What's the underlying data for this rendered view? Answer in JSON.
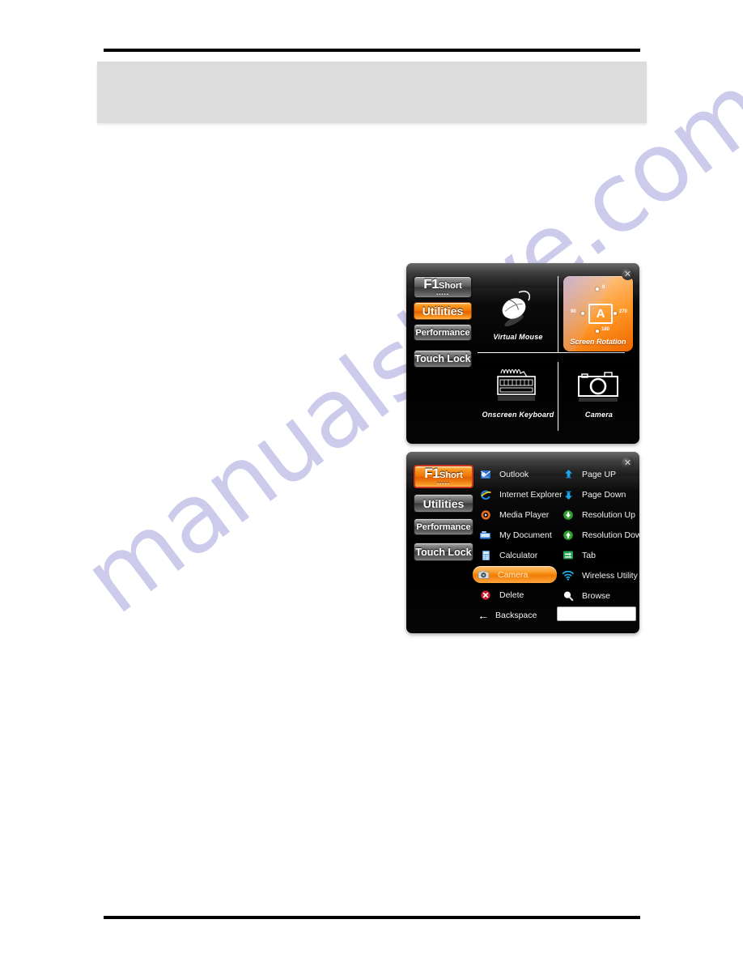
{
  "page": {
    "watermark_text": "manualshive.com"
  },
  "header": {
    "rule": "",
    "box_text": ""
  },
  "footer": {
    "rule": ""
  },
  "panel_utilities": {
    "close_label": "✕",
    "tabs": [
      {
        "id": "f1short",
        "label_main": "F1",
        "label_sub": "Short",
        "dots": "▪▪▪▪▪",
        "state": "normal"
      },
      {
        "id": "utilities",
        "label": "Utilities",
        "state": "active"
      },
      {
        "id": "performance",
        "label": "Performance",
        "state": "normal"
      },
      {
        "id": "touchlock",
        "label": "Touch Lock",
        "state": "normal"
      }
    ],
    "tiles": [
      {
        "id": "virtual-mouse",
        "label": "Virtual Mouse",
        "icon": "mouse-icon"
      },
      {
        "id": "screen-rotation",
        "label": "Screen Rotation",
        "icon": "screen-rotation-icon"
      },
      {
        "id": "onscreen-keyboard",
        "label": "Onscreen Keyboard",
        "icon": "keyboard-icon"
      },
      {
        "id": "camera",
        "label": "Camera",
        "icon": "camera-icon"
      }
    ],
    "rotation": {
      "center_letter": "A",
      "angles": {
        "top": "0",
        "left": "90",
        "right": "270",
        "bottom": "180"
      },
      "title": "Screen Rotation"
    }
  },
  "panel_f1short": {
    "close_label": "✕",
    "tabs": [
      {
        "id": "f1short",
        "label_main": "F1",
        "label_sub": "Short",
        "dots": "▪▪▪▪▪",
        "state": "active"
      },
      {
        "id": "utilities",
        "label": "Utilities",
        "state": "normal"
      },
      {
        "id": "performance",
        "label": "Performance",
        "state": "normal"
      },
      {
        "id": "touchlock",
        "label": "Touch Lock",
        "state": "normal"
      }
    ],
    "column_left": [
      {
        "id": "outlook",
        "label": "Outlook",
        "icon": "outlook-icon",
        "state": "normal"
      },
      {
        "id": "internet-explorer",
        "label": "Internet Explorer",
        "icon": "internet-explorer-icon",
        "state": "normal"
      },
      {
        "id": "media-player",
        "label": "Media Player",
        "icon": "media-player-icon",
        "state": "normal"
      },
      {
        "id": "my-document",
        "label": "My Document",
        "icon": "my-document-icon",
        "state": "normal"
      },
      {
        "id": "calculator",
        "label": "Calculator",
        "icon": "calculator-icon",
        "state": "normal"
      },
      {
        "id": "camera",
        "label": "Camera",
        "icon": "camera-small-icon",
        "state": "highlight"
      },
      {
        "id": "delete",
        "label": "Delete",
        "icon": "delete-icon",
        "state": "normal"
      }
    ],
    "column_right": [
      {
        "id": "page-up",
        "label": "Page UP",
        "icon": "page-up-icon",
        "state": "normal"
      },
      {
        "id": "page-down",
        "label": "Page Down",
        "icon": "page-down-icon",
        "state": "normal"
      },
      {
        "id": "resolution-up",
        "label": "Resolution Up",
        "icon": "resolution-up-icon",
        "state": "normal"
      },
      {
        "id": "resolution-down",
        "label": "Resolution Down",
        "icon": "resolution-down-icon",
        "state": "normal"
      },
      {
        "id": "tab",
        "label": "Tab",
        "icon": "tab-icon",
        "state": "normal"
      },
      {
        "id": "wireless-utility",
        "label": "Wireless Utility",
        "icon": "wireless-icon",
        "state": "normal"
      },
      {
        "id": "browse",
        "label": "Browse",
        "icon": "browse-icon",
        "state": "normal"
      }
    ],
    "backspace": {
      "label": "Backspace",
      "arrow": "←"
    },
    "text_input": {
      "value": "",
      "placeholder": ""
    }
  },
  "colors": {
    "accent_orange": "#f5870f",
    "panel_black": "#000000",
    "header_gray": "#dcdcdc",
    "watermark": "#c5c2e8"
  }
}
